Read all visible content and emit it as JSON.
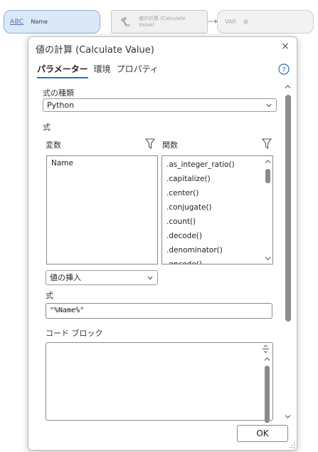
{
  "canvas": {
    "name_node": {
      "type_tag": "ABC",
      "label": "Name"
    },
    "tool_node": {
      "label": "値の計算 (Calculate Value)"
    },
    "var_node": {
      "type_tag": "VAR",
      "label": "値"
    }
  },
  "dialog": {
    "title": "値の計算 (Calculate Value)",
    "close_symbol": "×",
    "tabs": [
      {
        "label": "パラメーター",
        "active": true
      },
      {
        "label": "環境",
        "active": false
      },
      {
        "label": "プロパティ",
        "active": false
      }
    ],
    "expression_type": {
      "label": "式の種類",
      "value": "Python"
    },
    "expression_section_label": "式",
    "variables": {
      "label": "変数",
      "items": [
        "Name"
      ]
    },
    "functions": {
      "label": "関数",
      "items": [
        ".as_integer_ratio()",
        ".capitalize()",
        ".center()",
        ".conjugate()",
        ".count()",
        ".decode()",
        ".denominator()",
        ".encode()"
      ]
    },
    "insert_value": {
      "value": "値の挿入"
    },
    "expression": {
      "label": "式",
      "value": "\"%Name%\""
    },
    "code_block": {
      "label": "コード ブロック",
      "value": ""
    },
    "ok_label": "OK"
  },
  "colors": {
    "accent": "#2a6fb8",
    "name_node_fill": "#dbe8f7",
    "name_node_border": "#8fb0d8"
  }
}
